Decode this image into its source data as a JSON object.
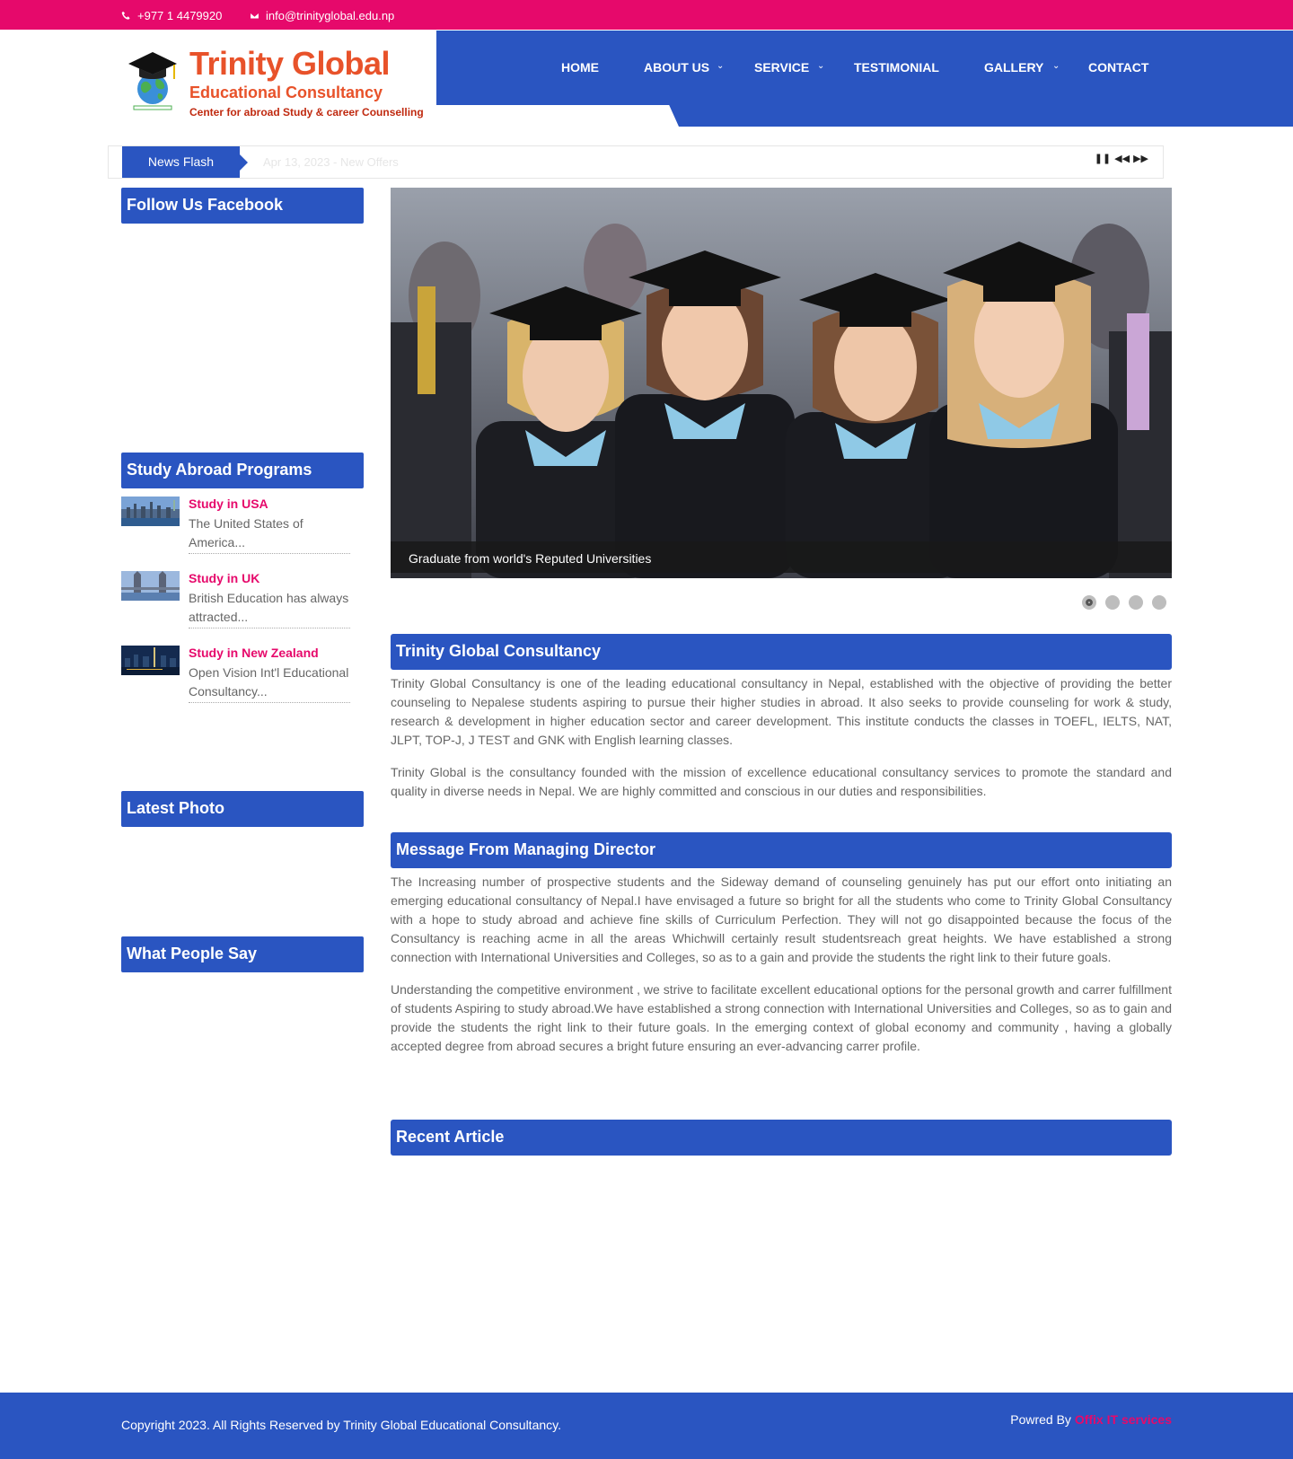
{
  "topbar": {
    "phone": "+977 1 4479920",
    "email": "info@trinityglobal.edu.np"
  },
  "logo": {
    "line1": "Trinity Global",
    "line2": "Educational Consultancy",
    "line3": "Center for abroad Study & career Counselling"
  },
  "nav": {
    "items": [
      {
        "label": "HOME",
        "dropdown": false
      },
      {
        "label": "ABOUT US",
        "dropdown": true
      },
      {
        "label": "SERVICE",
        "dropdown": true
      },
      {
        "label": "TESTIMONIAL",
        "dropdown": false
      },
      {
        "label": "GALLERY",
        "dropdown": true
      },
      {
        "label": "CONTACT",
        "dropdown": false
      }
    ]
  },
  "news": {
    "label": "News Flash",
    "ticker": "Apr 13, 2023 - New Offers"
  },
  "sidebar": {
    "facebook_title": "Follow Us Facebook",
    "programs_title": "Study Abroad Programs",
    "programs": [
      {
        "title": "Study in USA",
        "desc": "The United States of America..."
      },
      {
        "title": "Study in UK",
        "desc": "British Education has always attracted..."
      },
      {
        "title": "Study in New Zealand",
        "desc": "Open Vision Int'l Educational Consultancy..."
      }
    ],
    "photo_title": "Latest Photo",
    "people_title": "What People Say"
  },
  "slider": {
    "caption": "Graduate from world's Reputed Universities",
    "slides": 4,
    "active": 1
  },
  "main": {
    "about_title": "Trinity Global Consultancy",
    "about_p1": "Trinity Global Consultancy is one of the leading educational consultancy in Nepal, established with the objective of providing the better counseling to Nepalese students aspiring to pursue their higher studies in abroad. It also seeks to provide counseling for work & study, research & development in higher education sector and career development. This institute conducts the classes in TOEFL, IELTS, NAT, JLPT, TOP-J, J TEST and GNK with English learning classes.",
    "about_p2": "Trinity Global is the consultancy founded with the mission of excellence educational consultancy services to promote the standard and quality in diverse needs in Nepal. We are highly committed and conscious in our duties and responsibilities.",
    "md_title": "Message From Managing Director",
    "md_p1": "The Increasing number of prospective students and the Sideway demand of counseling genuinely has put our effort onto initiating an emerging educational consultancy of Nepal.I have envisaged a future so bright for all the students who come to Trinity Global Consultancy with a hope to study abroad and achieve fine skills of Curriculum Perfection. They will not go disappointed because the focus of the Consultancy is reaching acme in all the areas Whichwill certainly result studentsreach great heights. We have established a strong connection with International Universities and Colleges, so as to a gain and provide the students the right link to their future goals.",
    "md_p2": "Understanding the competitive environment , we strive to facilitate excellent educational options for the personal growth and carrer fulfillment of students Aspiring to study abroad.We have established a strong connection with International Universities and Colleges, so as to gain and provide the students the right link to their future goals. In the emerging context of global economy and community , having a globally accepted degree from abroad secures a bright future ensuring an ever-advancing carrer profile.",
    "recent_title": "Recent Article"
  },
  "footer": {
    "copyright": "Copyright 2023. All Rights Reserved by Trinity Global Educational Consultancy.",
    "powered_label": "Powred By",
    "powered_link": "Offix IT services"
  },
  "colors": {
    "brand_pink": "#e6096b",
    "brand_blue": "#2a55c1",
    "logo_orange": "#e8522a"
  }
}
